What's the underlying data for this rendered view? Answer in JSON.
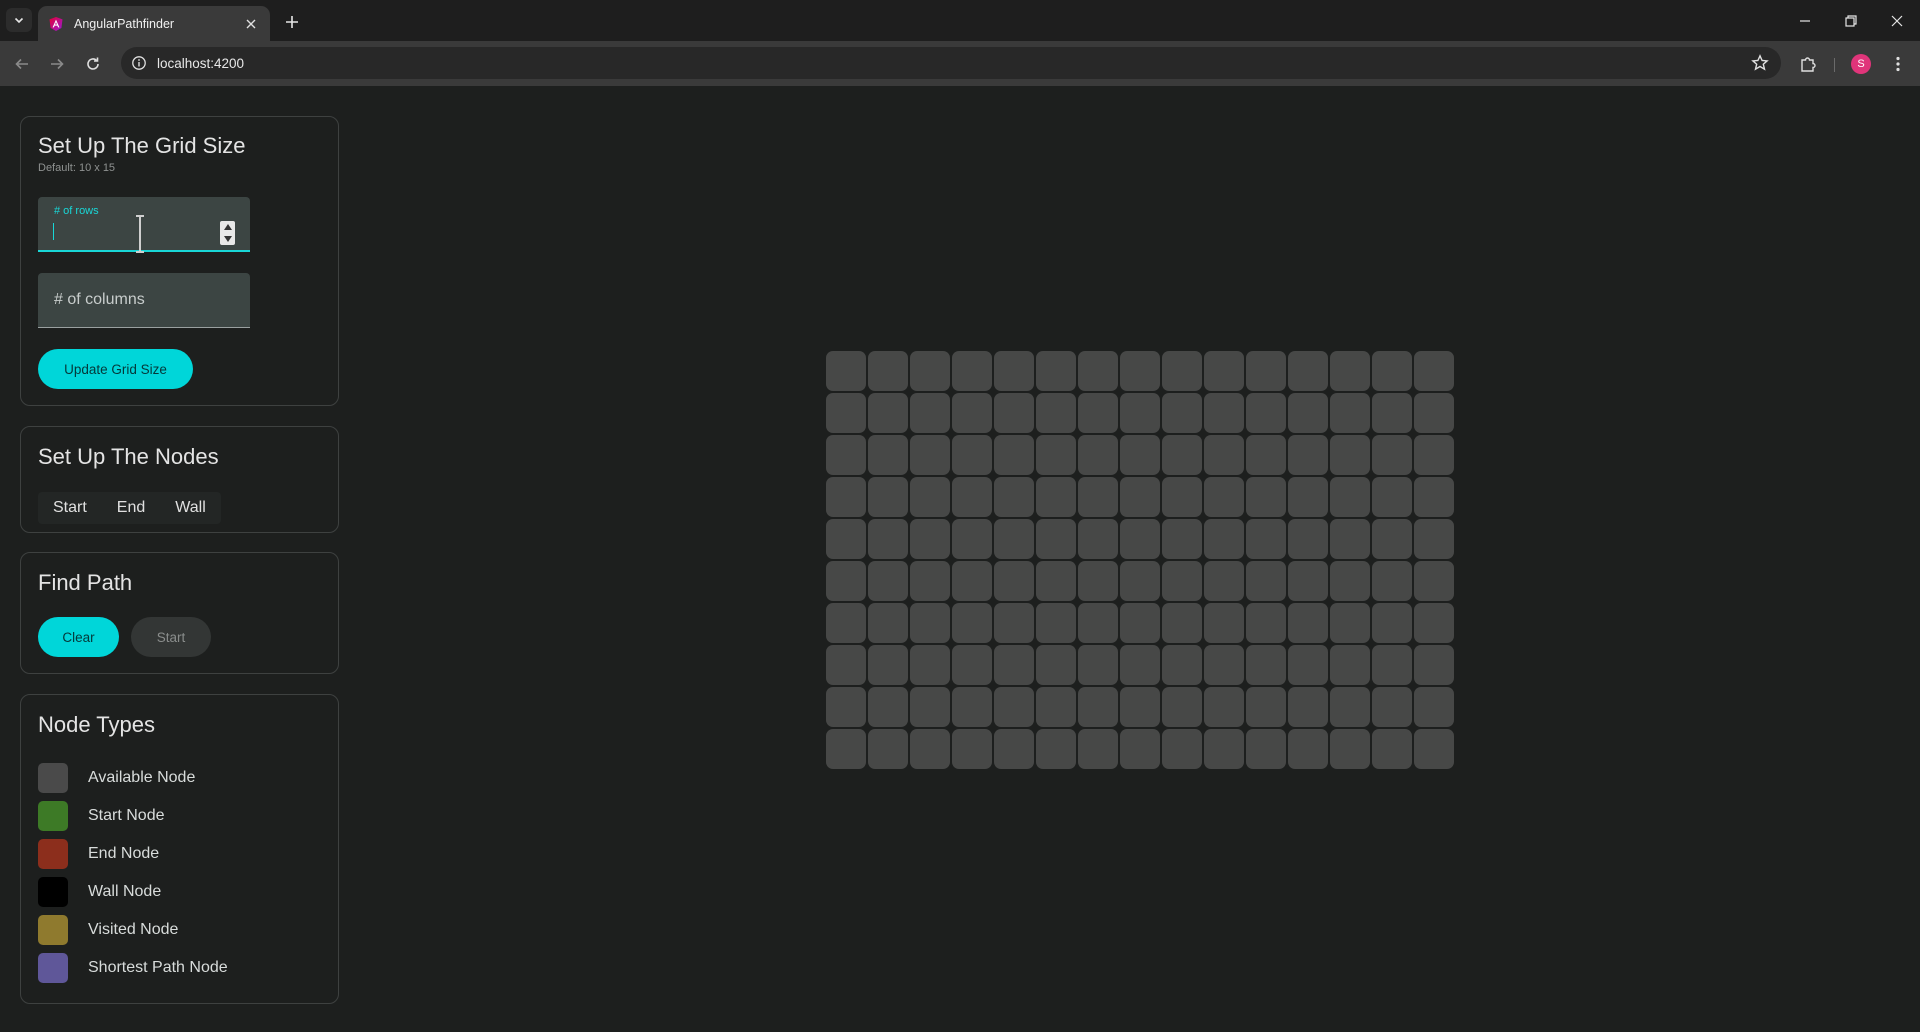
{
  "browser": {
    "tab_title": "AngularPathfinder",
    "url": "localhost:4200",
    "profile_initial": "S"
  },
  "grid_setup": {
    "title": "Set Up The Grid Size",
    "subtitle": "Default: 10 x 15",
    "rows_label": "# of rows",
    "rows_value": "",
    "columns_placeholder": "# of columns",
    "update_button": "Update Grid Size"
  },
  "nodes_setup": {
    "title": "Set Up The Nodes",
    "options": [
      "Start",
      "End",
      "Wall"
    ]
  },
  "find_path": {
    "title": "Find Path",
    "clear_button": "Clear",
    "start_button": "Start"
  },
  "node_types": {
    "title": "Node Types",
    "items": [
      {
        "label": "Available Node",
        "color": "#4a4a4a"
      },
      {
        "label": "Start Node",
        "color": "#3d7a26"
      },
      {
        "label": "End Node",
        "color": "#8c2e1c"
      },
      {
        "label": "Wall Node",
        "color": "#000000"
      },
      {
        "label": "Visited Node",
        "color": "#8f7a2e"
      },
      {
        "label": "Shortest Path Node",
        "color": "#5f5799"
      }
    ]
  },
  "grid": {
    "rows": 10,
    "columns": 15,
    "cell_color": "#474847"
  },
  "colors": {
    "accent": "#00d6d9",
    "background": "#1d1f1e"
  }
}
